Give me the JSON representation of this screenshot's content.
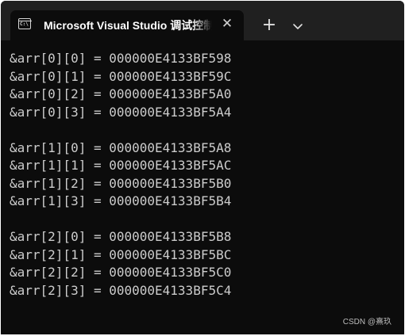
{
  "window": {
    "tab": {
      "icon": "console-app-icon",
      "icon_text": "C:\\",
      "title": "Microsoft Visual Studio 调试控制台",
      "close_glyph": "✕"
    },
    "new_tab_glyph": "+",
    "dropdown_icon": "chevron-down-icon"
  },
  "console": {
    "lines": [
      "&arr[0][0] = 000000E4133BF598",
      "&arr[0][1] = 000000E4133BF59C",
      "&arr[0][2] = 000000E4133BF5A0",
      "&arr[0][3] = 000000E4133BF5A4",
      "",
      "&arr[1][0] = 000000E4133BF5A8",
      "&arr[1][1] = 000000E4133BF5AC",
      "&arr[1][2] = 000000E4133BF5B0",
      "&arr[1][3] = 000000E4133BF5B4",
      "",
      "&arr[2][0] = 000000E4133BF5B8",
      "&arr[2][1] = 000000E4133BF5BC",
      "&arr[2][2] = 000000E4133BF5C0",
      "&arr[2][3] = 000000E4133BF5C4"
    ]
  },
  "watermark": "CSDN @熹玖"
}
